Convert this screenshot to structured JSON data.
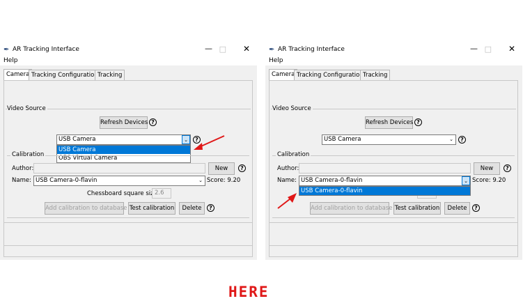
{
  "window": {
    "title": "AR Tracking Interface",
    "menu_help": "Help",
    "tabs": [
      "Camera",
      "Tracking Configuration",
      "Tracking"
    ]
  },
  "camera": {
    "video_source_label": "Video Source",
    "refresh_devices_label": "Refresh Devices",
    "selected_device": "USB Camera",
    "device_options": [
      "USB Camera",
      "OBS Virtual Camera"
    ]
  },
  "calibration": {
    "section_label": "Calibration",
    "author_label": "Author:",
    "author_value": "",
    "new_label": "New",
    "name_label": "Name:",
    "name_value": "USB Camera-0-flavin",
    "name_options": [
      "USB Camera-0-flavin"
    ],
    "score_text": "Score: 9.20",
    "chessboard_label": "Chessboard square size:",
    "chessboard_value": "2.6",
    "add_label": "Add calibration to database",
    "test_label": "Test calibration",
    "delete_label": "Delete"
  },
  "help_glyph": "?",
  "annotation": {
    "text": "HERE",
    "color": "#e01818"
  }
}
